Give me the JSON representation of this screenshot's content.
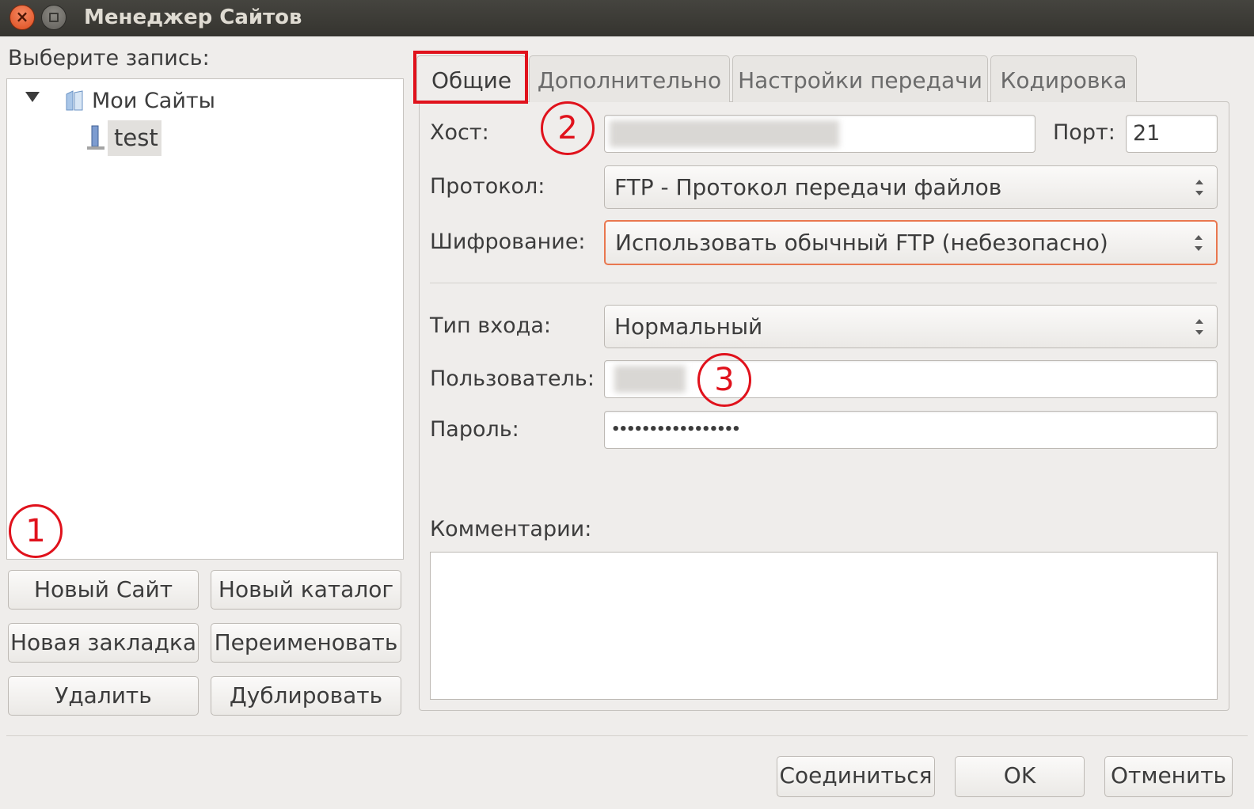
{
  "window": {
    "title": "Менеджер Сайтов",
    "close_glyph": "×"
  },
  "left": {
    "select_label": "Выберите запись:",
    "tree": {
      "root_label": "Мои Сайты",
      "child_label": "test"
    },
    "buttons": {
      "new_site": "Новый Сайт",
      "new_folder": "Новый каталог",
      "new_bookmark": "Новая закладка",
      "rename": "Переименовать",
      "delete": "Удалить",
      "duplicate": "Дублировать"
    }
  },
  "tabs": [
    "Общие",
    "Дополнительно",
    "Настройки передачи",
    "Кодировка"
  ],
  "general": {
    "host_label": "Хост:",
    "port_label": "Порт:",
    "port_value": "21",
    "protocol_label": "Протокол:",
    "protocol_value": "FTP - Протокол передачи файлов",
    "encryption_label": "Шифрование:",
    "encryption_value": "Использовать обычный FTP (небезопасно)",
    "logon_label": "Тип входа:",
    "logon_value": "Нормальный",
    "user_label": "Пользователь:",
    "password_label": "Пароль:",
    "password_value": "•••••••••••••••••",
    "comments_label": "Комментарии:"
  },
  "annotations": [
    "1",
    "2",
    "3"
  ],
  "dialog_buttons": {
    "connect": "Соединиться",
    "ok": "OK",
    "cancel": "Отменить"
  },
  "colors": {
    "annotation_red": "#e0121c",
    "focus_orange": "#e9774f",
    "titlebar": "#3d3c37"
  }
}
